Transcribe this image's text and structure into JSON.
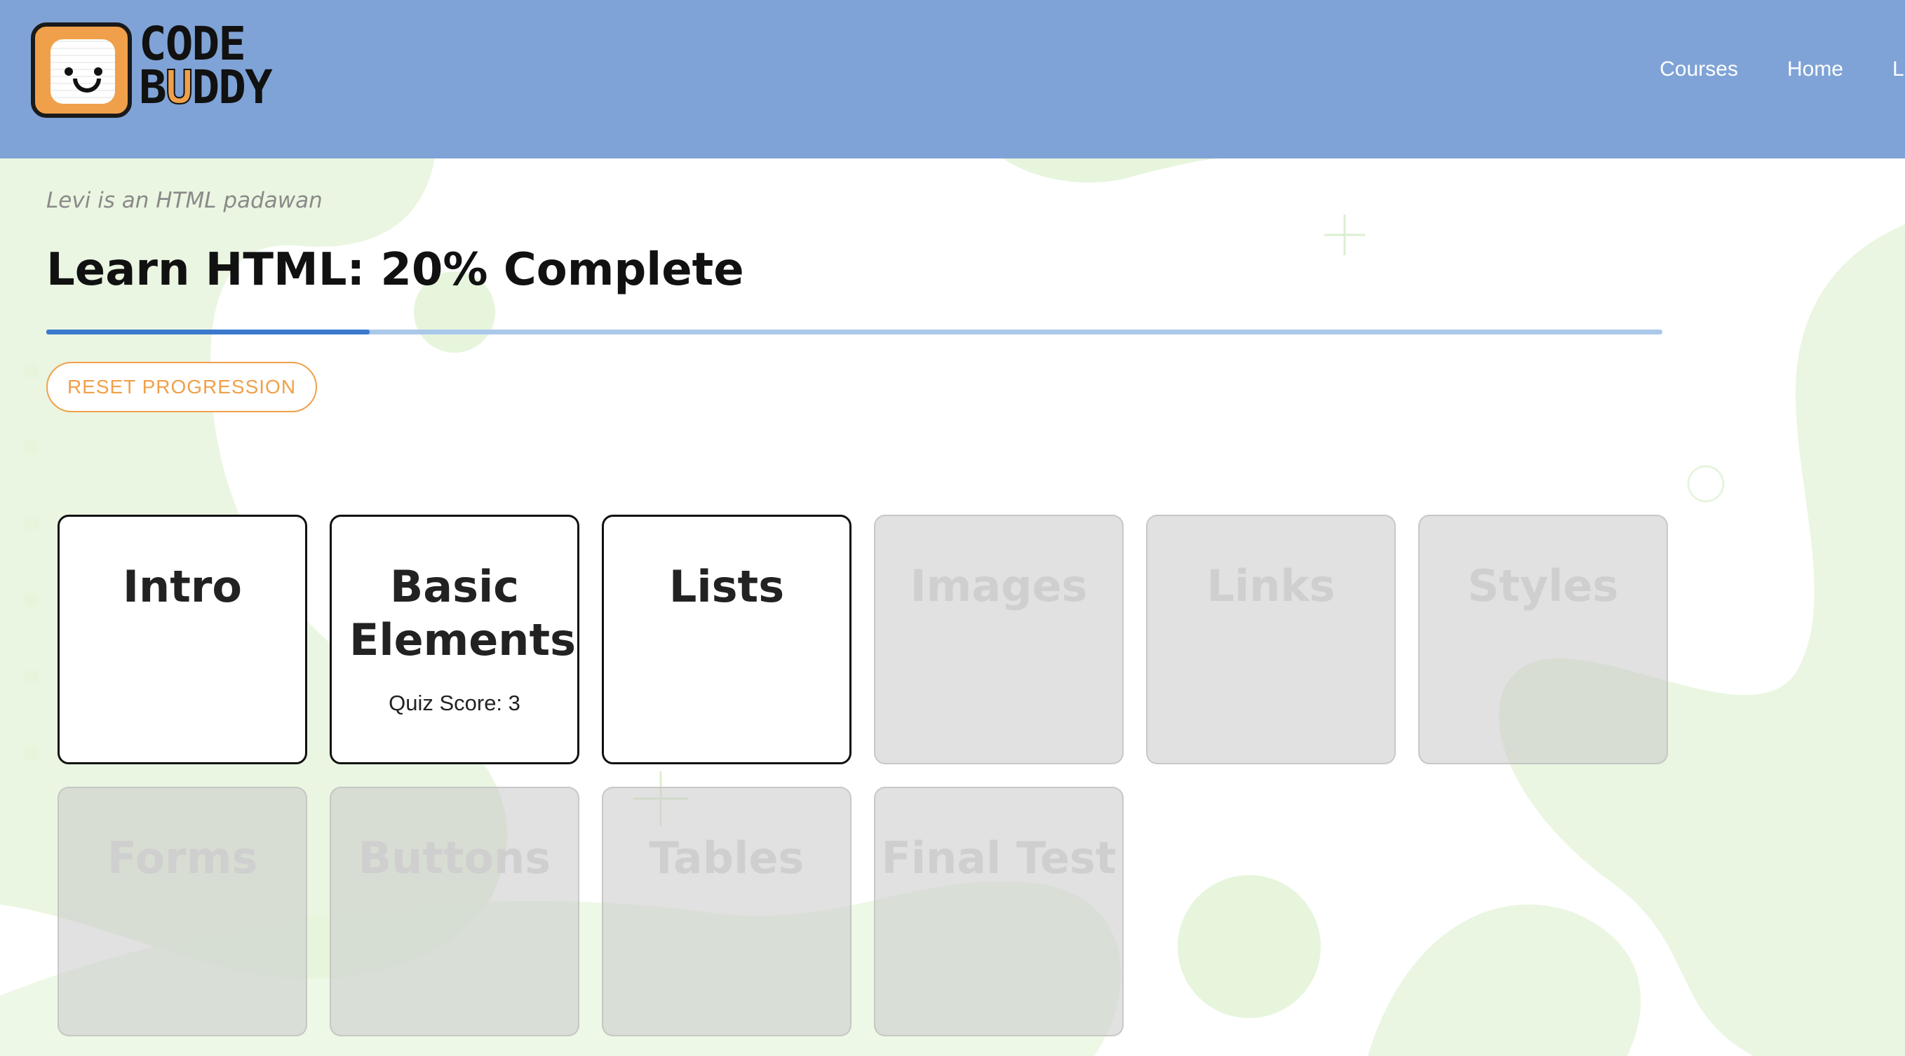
{
  "header": {
    "logo": {
      "line1": "CODE",
      "line2_b": "B",
      "line2_u": "U",
      "line2_rest": "DDY"
    },
    "nav": [
      "Courses",
      "Home",
      "L"
    ]
  },
  "page": {
    "subtitle": "Levi is an HTML padawan",
    "title": "Learn HTML: 20% Complete",
    "progress_fraction": 0.2,
    "reset_label": "RESET PROGRESSION"
  },
  "lessons": [
    {
      "title": "Intro",
      "score": "",
      "state": "open"
    },
    {
      "title": "Basic Elements",
      "score": "Quiz Score: 3",
      "state": "open"
    },
    {
      "title": "Lists",
      "score": "",
      "state": "open"
    },
    {
      "title": "Images",
      "score": "",
      "state": "locked"
    },
    {
      "title": "Links",
      "score": "",
      "state": "locked"
    },
    {
      "title": "Styles",
      "score": "",
      "state": "locked"
    },
    {
      "title": "Forms",
      "score": "",
      "state": "locked"
    },
    {
      "title": "Buttons",
      "score": "",
      "state": "locked"
    },
    {
      "title": "Tables",
      "score": "",
      "state": "locked"
    },
    {
      "title": "Final Test",
      "score": "",
      "state": "locked"
    }
  ],
  "colors": {
    "header": "#7fa3d6",
    "accent": "#f0a04a",
    "progress_fill": "#3b79cd",
    "progress_track": "#a9c8ea",
    "background_blob": "#e6f5dc"
  }
}
